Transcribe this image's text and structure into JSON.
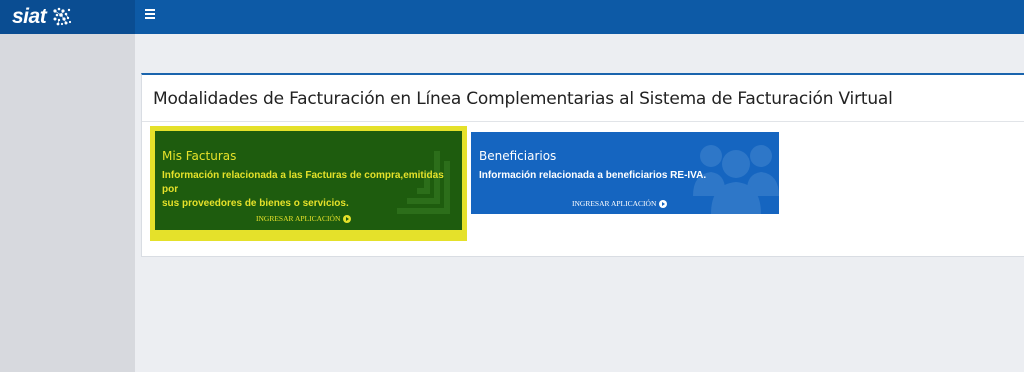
{
  "header": {
    "brand": "siat",
    "logo_icon": "siat-logo-icon",
    "menu_icon": "hamburger-menu-icon"
  },
  "panel": {
    "title": "Modalidades de Facturación en Línea Complementarias al Sistema de Facturación Virtual"
  },
  "cards": [
    {
      "title": "Mis Facturas",
      "description_lines": [
        "Información relacionada a las Facturas de compra,emitidas por",
        "sus proveedores de bienes o servicios."
      ],
      "link": "INGRESAR APLICACIÓN",
      "icon": "invoice-stack-icon",
      "color": "#1e5c0e",
      "text_color": "#e5e12a",
      "highlighted": true
    },
    {
      "title": "Beneficiarios",
      "description_lines": [
        "Información relacionada a beneficiarios RE-IVA."
      ],
      "link": "INGRESAR APLICACIÓN",
      "icon": "users-group-icon",
      "color": "#1565c0",
      "text_color": "#ffffff",
      "highlighted": false
    }
  ],
  "colors": {
    "topbar": "#0d5aa6",
    "brand_bg": "#0a4d92",
    "highlight": "#e5e12a"
  }
}
